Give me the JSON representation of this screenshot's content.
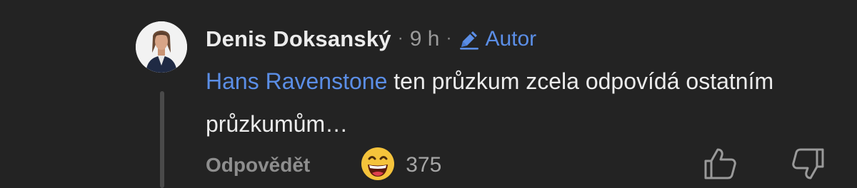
{
  "comment": {
    "author": "Denis Doksanský",
    "separator": "·",
    "time": "9 h",
    "badge_label": "Autor",
    "mention": "Hans Ravenstone",
    "text": " ten průzkum zcela odpovídá ostatním průzkumům…",
    "avatar_icon": "person-portrait-avatar"
  },
  "actions": {
    "reply_label": "Odpovědět",
    "reaction_icon": "grinning-face-emoji",
    "reaction_count": "375",
    "like_icon": "thumbs-up-icon",
    "dislike_icon": "thumbs-down-icon"
  },
  "colors": {
    "background": "#232323",
    "link_accent": "#5b8ee6",
    "text_primary": "#ececec",
    "text_muted": "#8e8e8e"
  }
}
